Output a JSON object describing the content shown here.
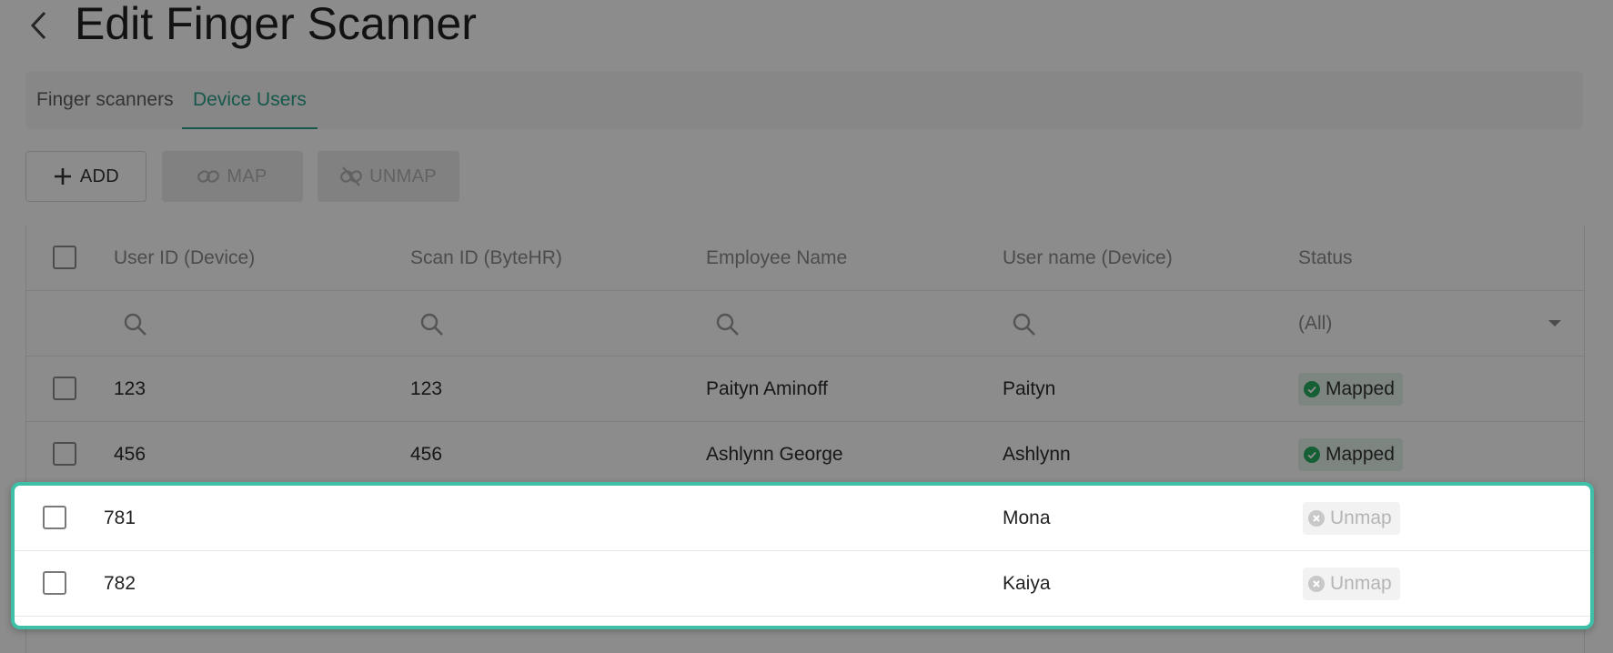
{
  "page": {
    "title": "Edit Finger Scanner"
  },
  "tabs": [
    {
      "label": "Finger scanners",
      "active": false
    },
    {
      "label": "Device Users",
      "active": true
    }
  ],
  "toolbar": {
    "add_label": "ADD",
    "map_label": "MAP",
    "unmap_label": "UNMAP"
  },
  "table": {
    "columns": [
      "User ID (Device)",
      "Scan ID (ByteHR)",
      "Employee Name",
      "User name (Device)",
      "Status"
    ],
    "status_filter": "(All)",
    "rows": [
      {
        "user_id": "123",
        "scan_id": "123",
        "employee": "Paityn Aminoff",
        "username": "Paityn",
        "status": "Mapped"
      },
      {
        "user_id": "456",
        "scan_id": "456",
        "employee": "Ashlynn George",
        "username": "Ashlynn",
        "status": "Mapped"
      },
      {
        "user_id": "781",
        "scan_id": "",
        "employee": "",
        "username": "Mona",
        "status": "Unmap"
      },
      {
        "user_id": "782",
        "scan_id": "",
        "employee": "",
        "username": "Kaiya",
        "status": "Unmap"
      }
    ]
  },
  "colors": {
    "accent": "#2aa08a",
    "highlight_border": "#3dbfa8",
    "mapped_icon": "#27ae60",
    "unmap_icon": "#c8c8c8"
  },
  "icons": [
    "back-chevron-icon",
    "plus-icon",
    "link-icon",
    "link-off-icon",
    "search-icon",
    "caret-down-icon",
    "check-circle-icon",
    "x-circle-icon"
  ]
}
